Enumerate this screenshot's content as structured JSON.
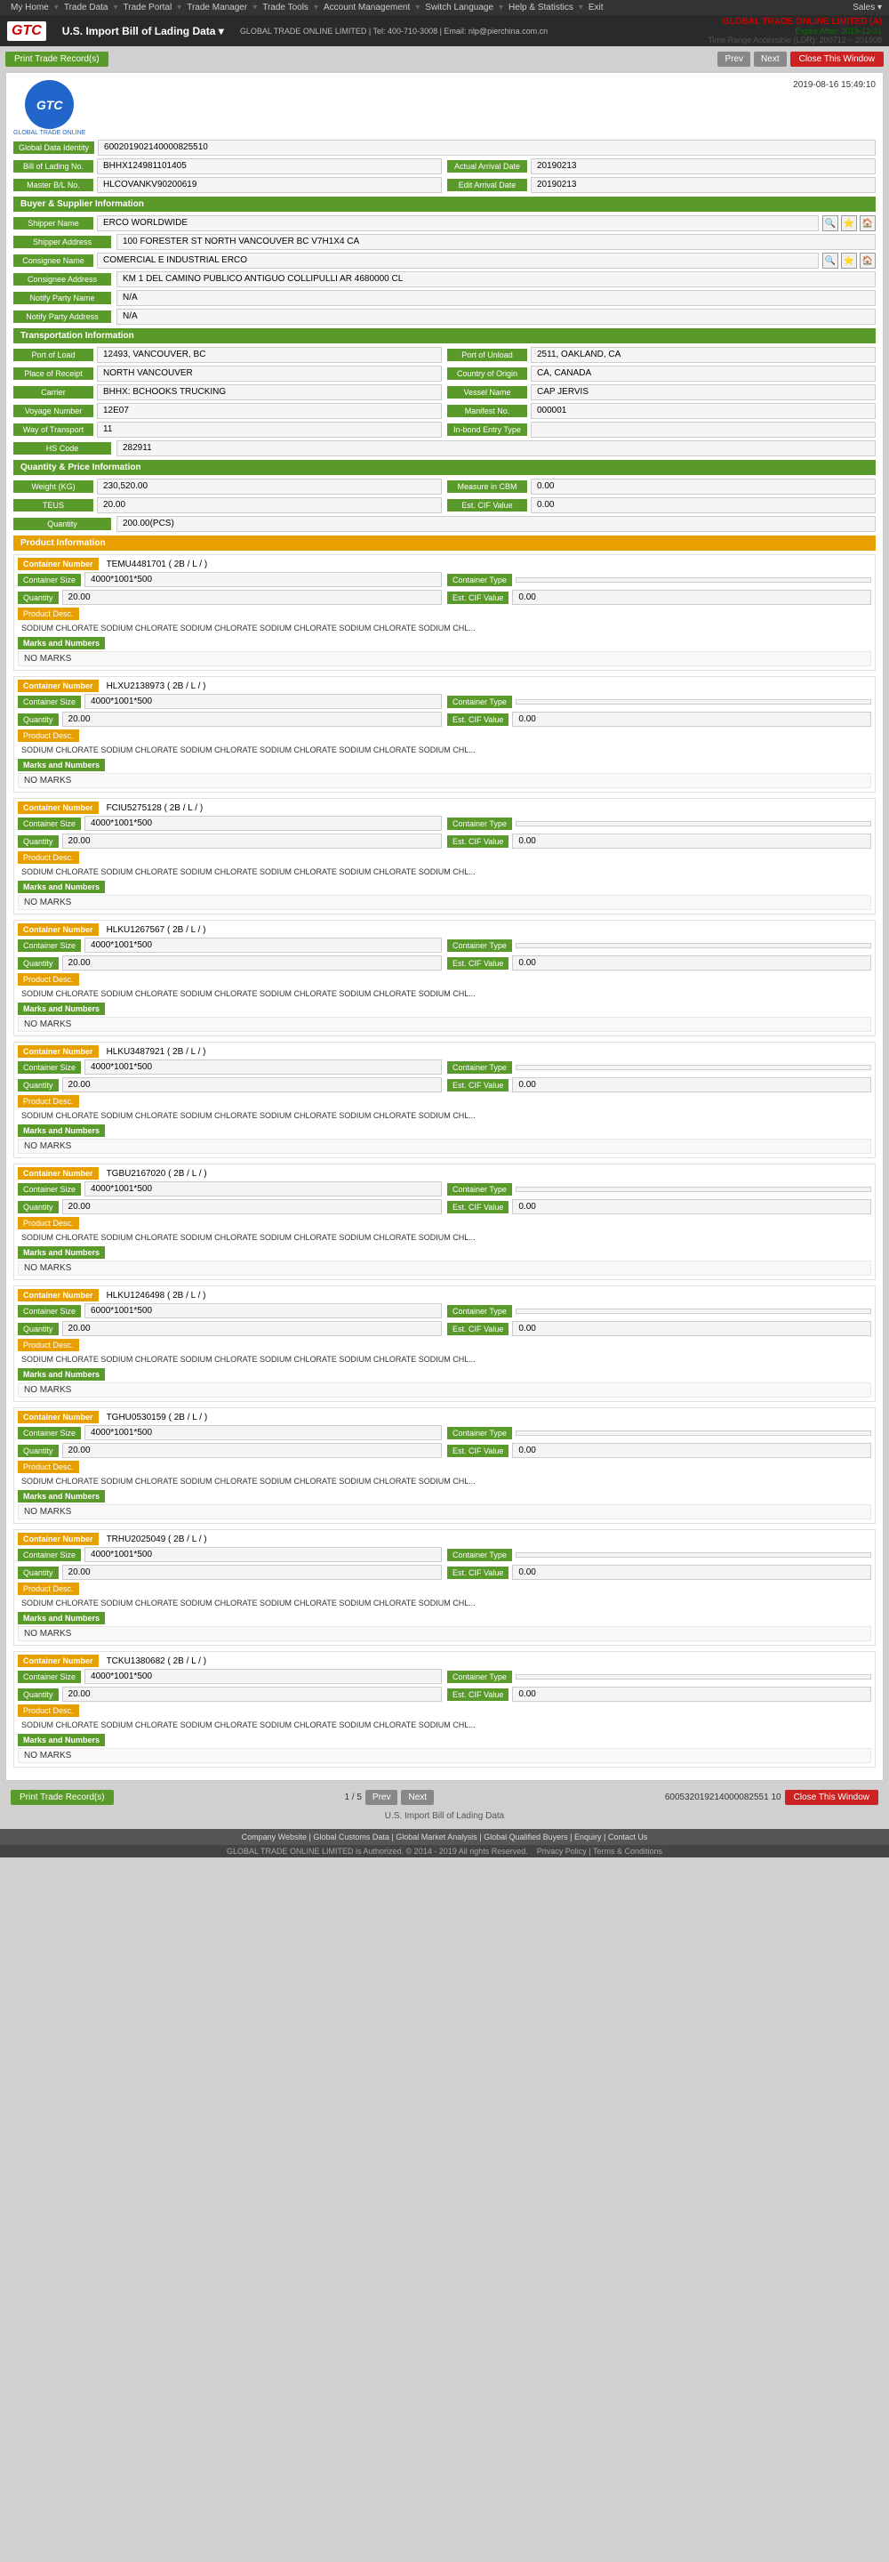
{
  "topnav": {
    "links": [
      "My Home",
      "Trade Data",
      "Trade Portal",
      "Trade Manager",
      "Trade Tools",
      "Account Management",
      "Switch Language",
      "Help & Statistics",
      "Exit"
    ],
    "right": "Sales"
  },
  "subnav": {
    "logo": "GTC",
    "company_line": "GLOBAL TRADE ONLINE LIMITED | Tel: 400-710-3008 | Email: nlp@pierchina.com.cn",
    "page_title": "U.S. Import Bill of Lading Data",
    "header_right": {
      "company": "GLOBAL TRADE ONLINE LIMITED (A)",
      "expire": "Expire After: 2019-12-31",
      "time_range": "Time Range Accessible (LDR): 200712 ~ 201908"
    }
  },
  "toolbar": {
    "print_btn": "Print Trade Record(s)",
    "prev_btn": "Prev",
    "next_btn": "Next",
    "close_btn": "Close This Window"
  },
  "card": {
    "global_data_id": "600201902140000825510",
    "bill_of_lading": "BHHX124981101405",
    "master_bl": "HLCOVANKV90200619",
    "actual_arrival_date": "20190213",
    "edit_arrival_date": "20190213",
    "date": "2019-08-16 15:49:10"
  },
  "buyer_supplier": {
    "title": "Buyer & Supplier Information",
    "shipper_name": "ERCO WORLDWIDE",
    "shipper_address": "100 FORESTER ST NORTH VANCOUVER BC V7H1X4 CA",
    "consignee_name": "COMERCIAL E INDUSTRIAL ERCO",
    "consignee_address": "KM 1 DEL CAMINO PUBLICO ANTIGUO COLLIPULLI AR 4680000 CL",
    "notify_party_name": "N/A",
    "notify_party_address": "N/A"
  },
  "transportation": {
    "title": "Transportation Information",
    "port_of_load": "12493, VANCOUVER, BC",
    "port_of_unload": "2511, OAKLAND, CA",
    "place_of_receipt": "NORTH VANCOUVER",
    "country_of_origin": "CA, CANADA",
    "carrier": "BHHX: BCHOOKS TRUCKING",
    "vessel_name": "CAP JERVIS",
    "voyage_number": "12E07",
    "manifest_no": "000001",
    "way_of_transport": "11",
    "in_bond_entry_type": "",
    "hs_code": "282911"
  },
  "quantity_price": {
    "title": "Quantity & Price Information",
    "weight_kg": "230,520.00",
    "measure_cbm": "0.00",
    "teus": "20.00",
    "est_cif_value": "0.00",
    "quantity": "200.00(PCS)"
  },
  "product_info": {
    "title": "Product Information",
    "containers": [
      {
        "container_number": "TEMU4481701 ( 2B / L / )",
        "container_size": "4000*1001*500",
        "container_type": "",
        "quantity": "20.00",
        "est_cif_value": "0.00",
        "product_desc": "SODIUM CHLORATE SODIUM CHLORATE SODIUM CHLORATE SODIUM CHLORATE SODIUM CHLORATE SODIUM CHL...",
        "marks": "NO MARKS"
      },
      {
        "container_number": "HLXU2138973 ( 2B / L / )",
        "container_size": "4000*1001*500",
        "container_type": "",
        "quantity": "20.00",
        "est_cif_value": "0.00",
        "product_desc": "SODIUM CHLORATE SODIUM CHLORATE SODIUM CHLORATE SODIUM CHLORATE SODIUM CHLORATE SODIUM CHL...",
        "marks": "NO MARKS"
      },
      {
        "container_number": "FCIU5275128 ( 2B / L / )",
        "container_size": "4000*1001*500",
        "container_type": "",
        "quantity": "20.00",
        "est_cif_value": "0.00",
        "product_desc": "SODIUM CHLORATE SODIUM CHLORATE SODIUM CHLORATE SODIUM CHLORATE SODIUM CHLORATE SODIUM CHL...",
        "marks": "NO MARKS"
      },
      {
        "container_number": "HLKU1267567 ( 2B / L / )",
        "container_size": "4000*1001*500",
        "container_type": "",
        "quantity": "20.00",
        "est_cif_value": "0.00",
        "product_desc": "SODIUM CHLORATE SODIUM CHLORATE SODIUM CHLORATE SODIUM CHLORATE SODIUM CHLORATE SODIUM CHL...",
        "marks": "NO MARKS"
      },
      {
        "container_number": "HLKU3487921 ( 2B / L / )",
        "container_size": "4000*1001*500",
        "container_type": "",
        "quantity": "20.00",
        "est_cif_value": "0.00",
        "product_desc": "SODIUM CHLORATE SODIUM CHLORATE SODIUM CHLORATE SODIUM CHLORATE SODIUM CHLORATE SODIUM CHL...",
        "marks": "NO MARKS"
      },
      {
        "container_number": "TGBU2167020 ( 2B / L / )",
        "container_size": "4000*1001*500",
        "container_type": "",
        "quantity": "20.00",
        "est_cif_value": "0.00",
        "product_desc": "SODIUM CHLORATE SODIUM CHLORATE SODIUM CHLORATE SODIUM CHLORATE SODIUM CHLORATE SODIUM CHL...",
        "marks": "NO MARKS"
      },
      {
        "container_number": "HLKU1246498 ( 2B / L / )",
        "container_size": "6000*1001*500",
        "container_type": "",
        "quantity": "20.00",
        "est_cif_value": "0.00",
        "product_desc": "SODIUM CHLORATE SODIUM CHLORATE SODIUM CHLORATE SODIUM CHLORATE SODIUM CHLORATE SODIUM CHL...",
        "marks": "NO MARKS"
      },
      {
        "container_number": "TGHU0530159 ( 2B / L / )",
        "container_size": "4000*1001*500",
        "container_type": "",
        "quantity": "20.00",
        "est_cif_value": "0.00",
        "product_desc": "SODIUM CHLORATE SODIUM CHLORATE SODIUM CHLORATE SODIUM CHLORATE SODIUM CHLORATE SODIUM CHL...",
        "marks": "NO MARKS"
      },
      {
        "container_number": "TRHU2025049 ( 2B / L / )",
        "container_size": "4000*1001*500",
        "container_type": "",
        "quantity": "20.00",
        "est_cif_value": "0.00",
        "product_desc": "SODIUM CHLORATE SODIUM CHLORATE SODIUM CHLORATE SODIUM CHLORATE SODIUM CHLORATE SODIUM CHL...",
        "marks": "NO MARKS"
      },
      {
        "container_number": "TCKU1380682 ( 2B / L / )",
        "container_size": "4000*1001*500",
        "container_type": "",
        "quantity": "20.00",
        "est_cif_value": "0.00",
        "product_desc": "SODIUM CHLORATE SODIUM CHLORATE SODIUM CHLORATE SODIUM CHLORATE SODIUM CHLORATE SODIUM CHL...",
        "marks": "NO MARKS"
      }
    ]
  },
  "bottom": {
    "page_title": "U.S. Import Bill of Lading Data",
    "page_info": "1 / 5",
    "record_id": "600532019214000082551 10",
    "prev_btn": "Prev",
    "next_btn": "Next",
    "print_btn": "Print Trade Record(s)",
    "close_btn": "Close This Window"
  },
  "footer": {
    "links": [
      "Company Website",
      "Global Customs Data",
      "Global Market Analysis",
      "Global Qualified Buyers",
      "Enquiry",
      "Contact Us"
    ],
    "copyright": "GLOBAL TRADE ONLINE LIMITED is Authorized. © 2014 - 2019 All rights Reserved.",
    "policy_links": [
      "Privacy Policy",
      "Terms & Conditions"
    ]
  }
}
